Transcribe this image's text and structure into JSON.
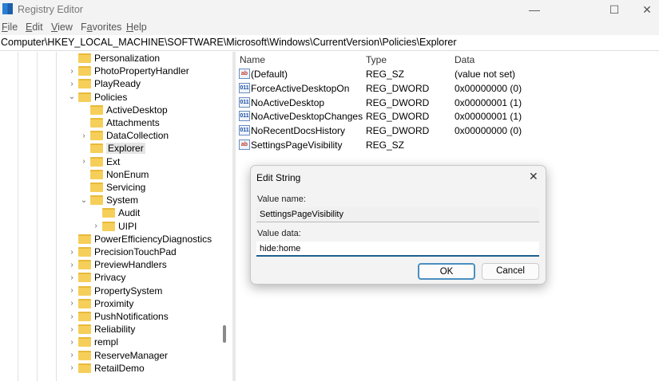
{
  "window": {
    "title": "Registry Editor",
    "minimize": "—",
    "maximize": "☐",
    "close": "✕"
  },
  "menu": [
    {
      "u": "F",
      "rest": "ile"
    },
    {
      "u": "E",
      "rest": "dit"
    },
    {
      "u": "V",
      "rest": "iew"
    },
    {
      "pre": "F",
      "u": "a",
      "rest": "vorites"
    },
    {
      "u": "H",
      "rest": "elp"
    }
  ],
  "address": "Computer\\HKEY_LOCAL_MACHINE\\SOFTWARE\\Microsoft\\Windows\\CurrentVersion\\Policies\\Explorer",
  "tree": [
    {
      "label": "Personalization",
      "level": 0,
      "exp": ""
    },
    {
      "label": "PhotoPropertyHandler",
      "level": 0,
      "exp": ">"
    },
    {
      "label": "PlayReady",
      "level": 0,
      "exp": ">"
    },
    {
      "label": "Policies",
      "level": 0,
      "exp": "v"
    },
    {
      "label": "ActiveDesktop",
      "level": 1,
      "exp": ""
    },
    {
      "label": "Attachments",
      "level": 1,
      "exp": ""
    },
    {
      "label": "DataCollection",
      "level": 1,
      "exp": ">"
    },
    {
      "label": "Explorer",
      "level": 1,
      "exp": "",
      "selected": true
    },
    {
      "label": "Ext",
      "level": 1,
      "exp": ">"
    },
    {
      "label": "NonEnum",
      "level": 1,
      "exp": ""
    },
    {
      "label": "Servicing",
      "level": 1,
      "exp": ""
    },
    {
      "label": "System",
      "level": 1,
      "exp": "v"
    },
    {
      "label": "Audit",
      "level": 2,
      "exp": ""
    },
    {
      "label": "UIPI",
      "level": 2,
      "exp": ">"
    },
    {
      "label": "PowerEfficiencyDiagnostics",
      "level": 0,
      "exp": ""
    },
    {
      "label": "PrecisionTouchPad",
      "level": 0,
      "exp": ">"
    },
    {
      "label": "PreviewHandlers",
      "level": 0,
      "exp": ">"
    },
    {
      "label": "Privacy",
      "level": 0,
      "exp": ">"
    },
    {
      "label": "PropertySystem",
      "level": 0,
      "exp": ">"
    },
    {
      "label": "Proximity",
      "level": 0,
      "exp": ">"
    },
    {
      "label": "PushNotifications",
      "level": 0,
      "exp": ">"
    },
    {
      "label": "Reliability",
      "level": 0,
      "exp": ">"
    },
    {
      "label": "rempl",
      "level": 0,
      "exp": ">"
    },
    {
      "label": "ReserveManager",
      "level": 0,
      "exp": ">"
    },
    {
      "label": "RetailDemo",
      "level": 0,
      "exp": ">"
    }
  ],
  "columns": {
    "name": "Name",
    "type": "Type",
    "data": "Data"
  },
  "values": [
    {
      "name": "(Default)",
      "type": "REG_SZ",
      "data": "(value not set)",
      "icon": "ab"
    },
    {
      "name": "ForceActiveDesktopOn",
      "type": "REG_DWORD",
      "data": "0x00000000 (0)",
      "icon": "011"
    },
    {
      "name": "NoActiveDesktop",
      "type": "REG_DWORD",
      "data": "0x00000001 (1)",
      "icon": "011"
    },
    {
      "name": "NoActiveDesktopChanges",
      "type": "REG_DWORD",
      "data": "0x00000001 (1)",
      "icon": "011"
    },
    {
      "name": "NoRecentDocsHistory",
      "type": "REG_DWORD",
      "data": "0x00000000 (0)",
      "icon": "011"
    },
    {
      "name": "SettingsPageVisibility",
      "type": "REG_SZ",
      "data": "",
      "icon": "ab"
    }
  ],
  "dialog": {
    "title": "Edit String",
    "close": "✕",
    "value_name_label": "Value name:",
    "value_name": "SettingsPageVisibility",
    "value_data_label": "Value data:",
    "value_data": "hide:home",
    "ok": "OK",
    "cancel": "Cancel"
  }
}
